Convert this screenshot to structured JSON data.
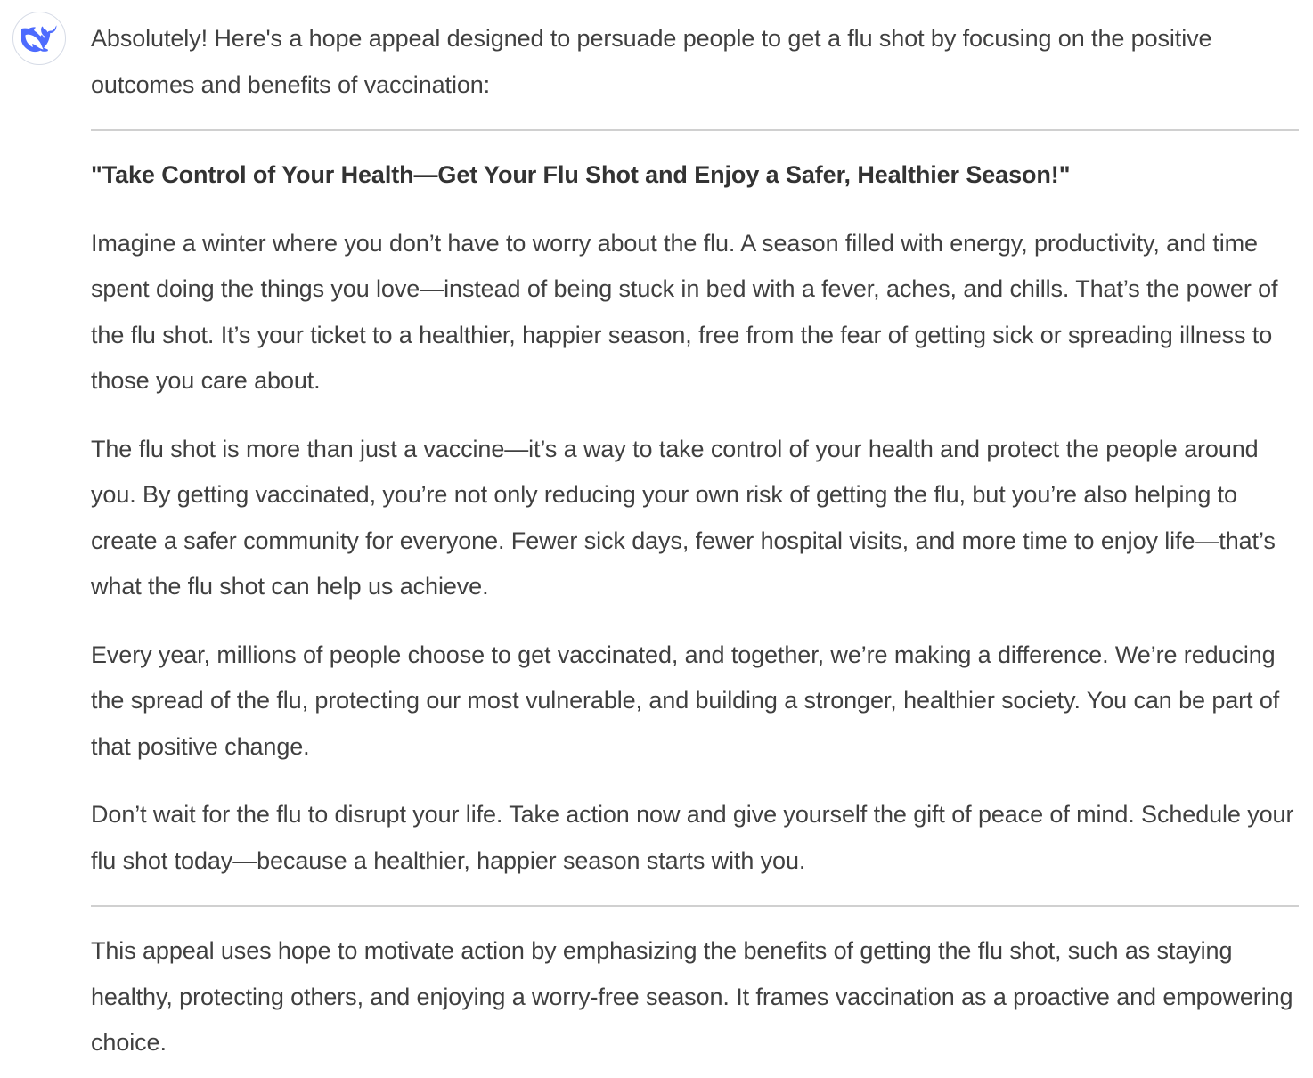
{
  "assistant": {
    "avatar_icon": "whale-logo-icon",
    "accent_color": "#4d6bfe"
  },
  "message": {
    "intro": "Absolutely! Here's a hope appeal designed to persuade people to get a flu shot by focusing on the positive outcomes and benefits of vaccination:",
    "title": "\"Take Control of Your Health—Get Your Flu Shot and Enjoy a Safer, Healthier Season!\"",
    "paragraphs": [
      "Imagine a winter where you don’t have to worry about the flu. A season filled with energy, productivity, and time spent doing the things you love—instead of being stuck in bed with a fever, aches, and chills. That’s the power of the flu shot. It’s your ticket to a healthier, happier season, free from the fear of getting sick or spreading illness to those you care about.",
      "The flu shot is more than just a vaccine—it’s a way to take control of your health and protect the people around you. By getting vaccinated, you’re not only reducing your own risk of getting the flu, but you’re also helping to create a safer community for everyone. Fewer sick days, fewer hospital visits, and more time to enjoy life—that’s what the flu shot can help us achieve.",
      "Every year, millions of people choose to get vaccinated, and together, we’re making a difference. We’re reducing the spread of the flu, protecting our most vulnerable, and building a stronger, healthier society. You can be part of that positive change.",
      "Don’t wait for the flu to disrupt your life. Take action now and give yourself the gift of peace of mind. Schedule your flu shot today—because a healthier, happier season starts with you."
    ],
    "conclusion": "This appeal uses hope to motivate action by emphasizing the benefits of getting the flu shot, such as staying healthy, protecting others, and enjoying a worry-free season. It frames vaccination as a proactive and empowering choice."
  }
}
